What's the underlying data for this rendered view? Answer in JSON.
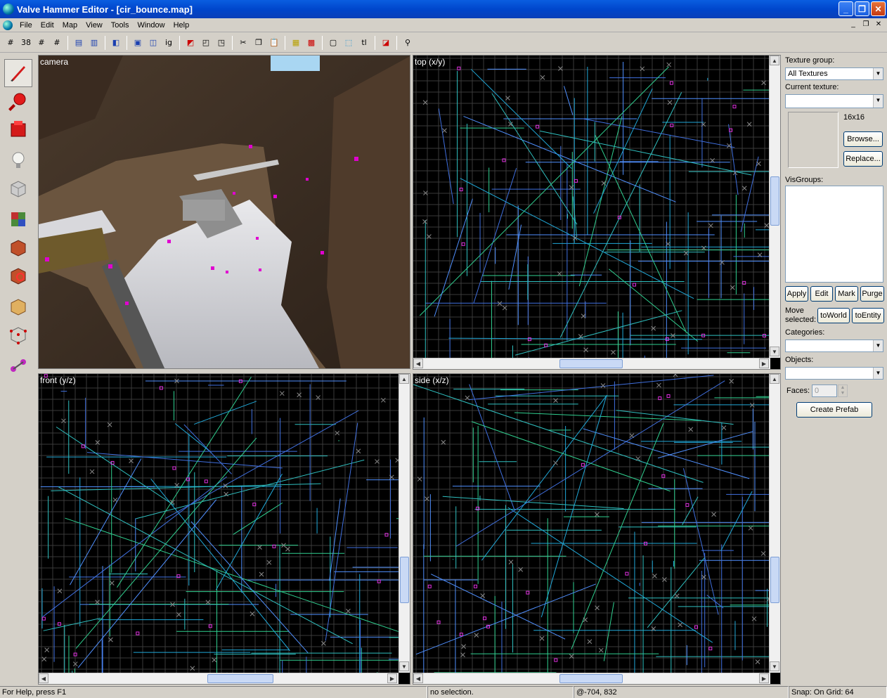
{
  "window": {
    "title": "Valve Hammer Editor - [cir_bounce.map]"
  },
  "menu": [
    "File",
    "Edit",
    "Map",
    "View",
    "Tools",
    "Window",
    "Help"
  ],
  "toolbar_text": {
    "snap_grid_icon": "38",
    "ig_label": "ig",
    "tl_label": "tl"
  },
  "viewports": {
    "camera": "camera",
    "top": "top (x/y)",
    "front": "front (y/z)",
    "side": "side (x/z)"
  },
  "right_panel": {
    "texture_group_label": "Texture group:",
    "texture_group_value": "All Textures",
    "current_texture_label": "Current texture:",
    "texture_size": "16x16",
    "browse": "Browse...",
    "replace": "Replace...",
    "visgroups_label": "VisGroups:",
    "apply": "Apply",
    "edit": "Edit",
    "mark": "Mark",
    "purge": "Purge",
    "move_selected": "Move selected:",
    "to_world": "toWorld",
    "to_entity": "toEntity",
    "categories_label": "Categories:",
    "objects_label": "Objects:",
    "faces_label": "Faces:",
    "faces_value": "0",
    "create_prefab": "Create Prefab"
  },
  "status": {
    "help": "For Help, press F1",
    "selection": "no selection.",
    "coords": "@-704, 832",
    "snap": "Snap: On Grid: 64"
  }
}
